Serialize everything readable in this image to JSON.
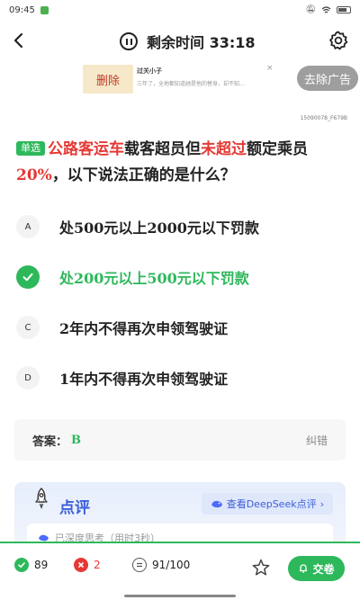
{
  "status_bar": {
    "time": "09:45"
  },
  "header": {
    "timer_label": "剩余时间 33:18"
  },
  "ad": {
    "delete_label": "删除",
    "title": "过关小子",
    "description": "三年了，全地都知道她是他的替身，却不知…",
    "close_symbol": "×",
    "remove_label": "去除广告"
  },
  "question": {
    "id_code": "15090078_F679B",
    "type_badge": "单选",
    "parts": [
      {
        "text": "公路客运车",
        "highlight": true
      },
      {
        "text": "载客超员但",
        "highlight": false
      },
      {
        "text": "未超过",
        "highlight": true
      },
      {
        "text": "额定乘员",
        "highlight": false
      },
      {
        "text": "20%",
        "highlight": true
      },
      {
        "text": "，以下说法正确的是什么？",
        "highlight": false
      }
    ]
  },
  "options": [
    {
      "letter": "A",
      "text": "处500元以上2000元以下罚款",
      "selected_correct": false
    },
    {
      "letter": "B",
      "text": "处200元以上500元以下罚款",
      "selected_correct": true
    },
    {
      "letter": "C",
      "text": "2年内不得再次申领驾驶证",
      "selected_correct": false
    },
    {
      "letter": "D",
      "text": "1年内不得再次申领驾驶证",
      "selected_correct": false
    }
  ],
  "answer": {
    "label": "答案：",
    "value": "B",
    "report_label": "纠错"
  },
  "review": {
    "title": "点评",
    "deepseek_label": "查看DeepSeek点评",
    "chevron": "›",
    "thinking_text": "已深度思考（用时3秒）"
  },
  "bottom_bar": {
    "correct_count": "89",
    "wrong_count": "2",
    "progress_text": "91/100",
    "submit_label": "交卷"
  },
  "colors": {
    "accent_green": "#2eb85c",
    "highlight_red": "#e53935",
    "review_blue": "#3b5ed8",
    "ad_gray": "#9e9e9e"
  },
  "icons": [
    "back-arrow-icon",
    "pause-icon",
    "gear-icon",
    "check-icon",
    "rocket-icon",
    "deepseek-whale-icon",
    "star-icon",
    "bell-icon"
  ]
}
